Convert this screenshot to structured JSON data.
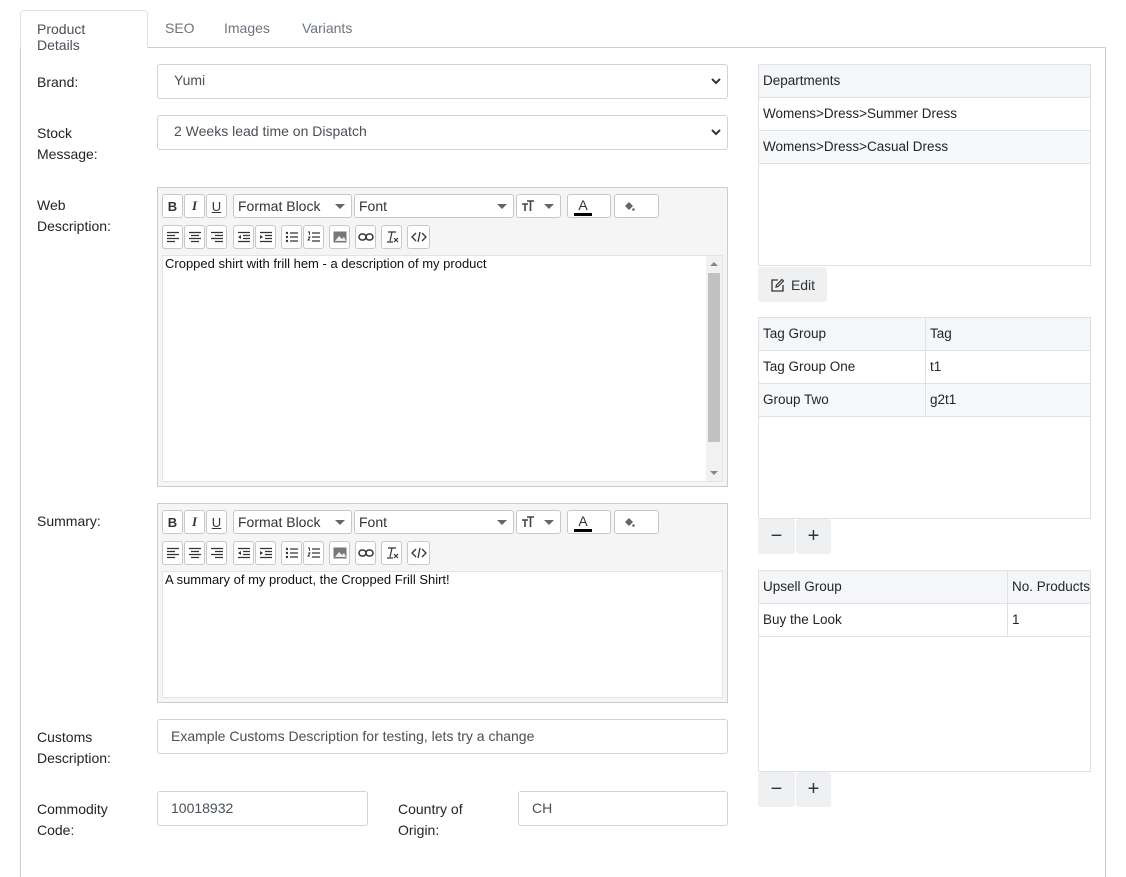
{
  "tabs": [
    {
      "label": "Product Details",
      "active": true
    },
    {
      "label": "SEO",
      "active": false
    },
    {
      "label": "Images",
      "active": false
    },
    {
      "label": "Variants",
      "active": false
    }
  ],
  "form": {
    "brand_label": "Brand:",
    "brand_value": "Yumi",
    "stock_label_1": "Stock",
    "stock_label_2": "Message:",
    "stock_value": "2 Weeks lead time on Dispatch",
    "webdesc_label_1": "Web",
    "webdesc_label_2": "Description:",
    "webdesc_text": "Cropped shirt with frill hem - a description of my product",
    "summary_label": "Summary:",
    "summary_text": "A summary of my product, the Cropped Frill Shirt!",
    "customs_label_1": "Customs",
    "customs_label_2": "Description:",
    "customs_value": "Example Customs Description for testing, lets try a change",
    "commodity_label_1": "Commodity",
    "commodity_label_2": "Code:",
    "commodity_value": "10018932",
    "origin_label_1": "Country of",
    "origin_label_2": "Origin:",
    "origin_value": "CH"
  },
  "editor_toolbar": {
    "bold": "B",
    "italic": "I",
    "underline": "U",
    "format_block": "Format Block",
    "font": "Font",
    "font_color": "A"
  },
  "departments": {
    "header": "Departments",
    "items": [
      "Womens>Dress>Summer Dress",
      "Womens>Dress>Casual Dress"
    ],
    "edit_label": "Edit"
  },
  "tags": {
    "headers": [
      "Tag Group",
      "Tag"
    ],
    "rows": [
      [
        "Tag Group One",
        "t1"
      ],
      [
        "Group Two",
        "g2t1"
      ]
    ],
    "minus": "−",
    "plus": "+"
  },
  "upsell": {
    "headers": [
      "Upsell Group",
      "No. Products"
    ],
    "rows": [
      [
        "Buy the Look",
        "1"
      ]
    ],
    "minus": "−",
    "plus": "+"
  },
  "colors": {
    "accent": "#495057",
    "border": "#ced4da",
    "toolbar_bg": "#f5f5f5",
    "header_bg": "#f5f6f7"
  }
}
